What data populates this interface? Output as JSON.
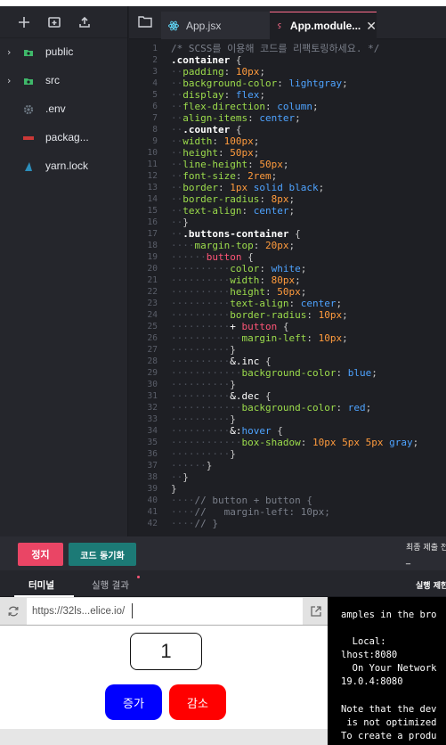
{
  "sidebar": {
    "toolbar": [
      "new-file-icon",
      "new-folder-icon",
      "upload-icon"
    ],
    "items": [
      {
        "name": "public",
        "icon": "folder-icon",
        "expandable": true
      },
      {
        "name": "src",
        "icon": "folder-icon",
        "expandable": true
      },
      {
        "name": ".env",
        "icon": "gear-icon",
        "expandable": false
      },
      {
        "name": "packag...",
        "icon": "npm-icon",
        "expandable": false
      },
      {
        "name": "yarn.lock",
        "icon": "yarn-icon",
        "expandable": false
      }
    ]
  },
  "editor": {
    "tabs": [
      {
        "label": "App.jsx",
        "icon": "react-icon",
        "active": false
      },
      {
        "label": "App.module...",
        "icon": "sass-icon",
        "active": true
      }
    ],
    "line_numbers": [
      "1",
      "2",
      "3",
      "4",
      "5",
      "6",
      "7",
      "8",
      "9",
      "10",
      "11",
      "12",
      "13",
      "14",
      "15",
      "16",
      "17",
      "18",
      "19",
      "20",
      "21",
      "22",
      "23",
      "24",
      "25",
      "26",
      "27",
      "28",
      "29",
      "30",
      "31",
      "32",
      "33",
      "34",
      "35",
      "36",
      "37",
      "38",
      "39",
      "40",
      "41",
      "42"
    ],
    "code": [
      [
        [
          "c-com",
          "/* SCSS를 이용해 코드를 리팩토링하세요. */"
        ]
      ],
      [
        [
          "c-sel",
          ".container"
        ],
        [
          "c-pun",
          " {"
        ]
      ],
      [
        [
          "ws",
          "··"
        ],
        [
          "c-prop",
          "padding"
        ],
        [
          "c-pun",
          ": "
        ],
        [
          "c-num",
          "10px"
        ],
        [
          "c-pun",
          ";"
        ]
      ],
      [
        [
          "ws",
          "··"
        ],
        [
          "c-prop",
          "background-color"
        ],
        [
          "c-pun",
          ": "
        ],
        [
          "c-val",
          "lightgray"
        ],
        [
          "c-pun",
          ";"
        ]
      ],
      [
        [
          "ws",
          "··"
        ],
        [
          "c-prop",
          "display"
        ],
        [
          "c-pun",
          ": "
        ],
        [
          "c-val",
          "flex"
        ],
        [
          "c-pun",
          ";"
        ]
      ],
      [
        [
          "ws",
          "··"
        ],
        [
          "c-prop",
          "flex-direction"
        ],
        [
          "c-pun",
          ": "
        ],
        [
          "c-val",
          "column"
        ],
        [
          "c-pun",
          ";"
        ]
      ],
      [
        [
          "ws",
          "··"
        ],
        [
          "c-prop",
          "align-items"
        ],
        [
          "c-pun",
          ": "
        ],
        [
          "c-val",
          "center"
        ],
        [
          "c-pun",
          ";"
        ]
      ],
      [
        [
          "ws",
          "··"
        ],
        [
          "c-sel",
          ".counter"
        ],
        [
          "c-pun",
          " {"
        ]
      ],
      [
        [
          "ws",
          "··"
        ],
        [
          "c-prop",
          "width"
        ],
        [
          "c-pun",
          ": "
        ],
        [
          "c-num",
          "100px"
        ],
        [
          "c-pun",
          ";"
        ]
      ],
      [
        [
          "ws",
          "··"
        ],
        [
          "c-prop",
          "height"
        ],
        [
          "c-pun",
          ": "
        ],
        [
          "c-num",
          "50px"
        ],
        [
          "c-pun",
          ";"
        ]
      ],
      [
        [
          "ws",
          "··"
        ],
        [
          "c-prop",
          "line-height"
        ],
        [
          "c-pun",
          ": "
        ],
        [
          "c-num",
          "50px"
        ],
        [
          "c-pun",
          ";"
        ]
      ],
      [
        [
          "ws",
          "··"
        ],
        [
          "c-prop",
          "font-size"
        ],
        [
          "c-pun",
          ": "
        ],
        [
          "c-num",
          "2rem"
        ],
        [
          "c-pun",
          ";"
        ]
      ],
      [
        [
          "ws",
          "··"
        ],
        [
          "c-prop",
          "border"
        ],
        [
          "c-pun",
          ": "
        ],
        [
          "c-num",
          "1px"
        ],
        [
          "c-val",
          " solid"
        ],
        [
          "c-val",
          " black"
        ],
        [
          "c-pun",
          ";"
        ]
      ],
      [
        [
          "ws",
          "··"
        ],
        [
          "c-prop",
          "border-radius"
        ],
        [
          "c-pun",
          ": "
        ],
        [
          "c-num",
          "8px"
        ],
        [
          "c-pun",
          ";"
        ]
      ],
      [
        [
          "ws",
          "··"
        ],
        [
          "c-prop",
          "text-align"
        ],
        [
          "c-pun",
          ": "
        ],
        [
          "c-val",
          "center"
        ],
        [
          "c-pun",
          ";"
        ]
      ],
      [
        [
          "ws",
          "··"
        ],
        [
          "c-pun",
          "}"
        ]
      ],
      [
        [
          "ws",
          "··"
        ],
        [
          "c-sel",
          ".buttons-container"
        ],
        [
          "c-pun",
          " {"
        ]
      ],
      [
        [
          "ws",
          "····"
        ],
        [
          "c-prop",
          "margin-top"
        ],
        [
          "c-pun",
          ": "
        ],
        [
          "c-num",
          "20px"
        ],
        [
          "c-pun",
          ";"
        ]
      ],
      [
        [
          "ws",
          "······"
        ],
        [
          "c-tag",
          "button"
        ],
        [
          "c-pun",
          " {"
        ]
      ],
      [
        [
          "ws",
          "··········"
        ],
        [
          "c-prop",
          "color"
        ],
        [
          "c-pun",
          ": "
        ],
        [
          "c-val",
          "white"
        ],
        [
          "c-pun",
          ";"
        ]
      ],
      [
        [
          "ws",
          "··········"
        ],
        [
          "c-prop",
          "width"
        ],
        [
          "c-pun",
          ": "
        ],
        [
          "c-num",
          "80px"
        ],
        [
          "c-pun",
          ";"
        ]
      ],
      [
        [
          "ws",
          "··········"
        ],
        [
          "c-prop",
          "height"
        ],
        [
          "c-pun",
          ": "
        ],
        [
          "c-num",
          "50px"
        ],
        [
          "c-pun",
          ";"
        ]
      ],
      [
        [
          "ws",
          "··········"
        ],
        [
          "c-prop",
          "text-align"
        ],
        [
          "c-pun",
          ": "
        ],
        [
          "c-val",
          "center"
        ],
        [
          "c-pun",
          ";"
        ]
      ],
      [
        [
          "ws",
          "··········"
        ],
        [
          "c-prop",
          "border-radius"
        ],
        [
          "c-pun",
          ": "
        ],
        [
          "c-num",
          "10px"
        ],
        [
          "c-pun",
          ";"
        ]
      ],
      [
        [
          "ws",
          "··········"
        ],
        [
          "c-amp",
          "+ "
        ],
        [
          "c-tag",
          "button"
        ],
        [
          "c-pun",
          " {"
        ]
      ],
      [
        [
          "ws",
          "············"
        ],
        [
          "c-prop",
          "margin-left"
        ],
        [
          "c-pun",
          ": "
        ],
        [
          "c-num",
          "10px"
        ],
        [
          "c-pun",
          ";"
        ]
      ],
      [
        [
          "ws",
          "··········"
        ],
        [
          "c-pun",
          "}"
        ]
      ],
      [
        [
          "ws",
          "··········"
        ],
        [
          "c-amp",
          "&.inc"
        ],
        [
          "c-pun",
          " {"
        ]
      ],
      [
        [
          "ws",
          "············"
        ],
        [
          "c-prop",
          "background-color"
        ],
        [
          "c-pun",
          ": "
        ],
        [
          "c-val",
          "blue"
        ],
        [
          "c-pun",
          ";"
        ]
      ],
      [
        [
          "ws",
          "··········"
        ],
        [
          "c-pun",
          "}"
        ]
      ],
      [
        [
          "ws",
          "··········"
        ],
        [
          "c-amp",
          "&.dec"
        ],
        [
          "c-pun",
          " {"
        ]
      ],
      [
        [
          "ws",
          "············"
        ],
        [
          "c-prop",
          "background-color"
        ],
        [
          "c-pun",
          ": "
        ],
        [
          "c-val",
          "red"
        ],
        [
          "c-pun",
          ";"
        ]
      ],
      [
        [
          "ws",
          "··········"
        ],
        [
          "c-pun",
          "}"
        ]
      ],
      [
        [
          "ws",
          "··········"
        ],
        [
          "c-amp",
          "&:"
        ],
        [
          "c-val",
          "hover"
        ],
        [
          "c-pun",
          " {"
        ]
      ],
      [
        [
          "ws",
          "············"
        ],
        [
          "c-prop",
          "box-shadow"
        ],
        [
          "c-pun",
          ": "
        ],
        [
          "c-num",
          "10px 5px 5px"
        ],
        [
          "c-val",
          " gray"
        ],
        [
          "c-pun",
          ";"
        ]
      ],
      [
        [
          "ws",
          "··········"
        ],
        [
          "c-pun",
          "}"
        ]
      ],
      [
        [
          "ws",
          "······"
        ],
        [
          "c-pun",
          "}"
        ]
      ],
      [
        [
          "ws",
          "··"
        ],
        [
          "c-pun",
          "}"
        ]
      ],
      [
        [
          "c-pun",
          "}"
        ]
      ],
      [
        [
          "ws",
          "····"
        ],
        [
          "c-com",
          "// button + button {"
        ]
      ],
      [
        [
          "ws",
          "····"
        ],
        [
          "c-com",
          "//   margin-left: 10px;"
        ]
      ],
      [
        [
          "ws",
          "····"
        ],
        [
          "c-com",
          "// }"
        ]
      ]
    ]
  },
  "actions": {
    "run_label": "정지",
    "sync_label": "코드 동기화",
    "last_submit_label": "최종 제출 전",
    "last_submit_value": "_"
  },
  "bottom_tabs": {
    "terminal_label": "터미널",
    "result_label": "실행 결과",
    "run_env_label": "실행 제한"
  },
  "preview": {
    "url": "https://32ls...elice.io/",
    "counter_value": "1",
    "inc_label": "증가",
    "dec_label": "감소"
  },
  "terminal": {
    "lines": [
      "amples in the bro",
      "",
      "  Local:",
      "lhost:8080",
      "  On Your Network",
      "19.0.4:8080",
      "",
      "Note that the dev",
      " is not optimized",
      "To create a produ"
    ]
  },
  "colors": {
    "run_button": "#ea4565",
    "sync_button": "#1c7a76",
    "inc_button": "#0000ff",
    "dec_button": "#ff0000",
    "active_tab_accent": "#ff6b8b"
  }
}
